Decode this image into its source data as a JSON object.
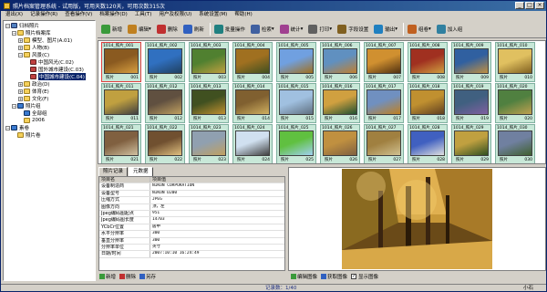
{
  "window": {
    "title": "照片档案管理系统 - 试用版，可用天数120天，可用次数315次"
  },
  "menu": [
    "退出(X)",
    "记录操作(R)",
    "查看操作(V)",
    "档案操作(D)",
    "工具(T)",
    "用户及权限(U)",
    "系统设置(M)",
    "帮助(H)"
  ],
  "tree": [
    {
      "label": "归档照片",
      "level": 0,
      "exp": "−",
      "icon": "root-icon"
    },
    {
      "label": "照片档案库",
      "level": 1,
      "exp": "−",
      "icon": "folder-icon"
    },
    {
      "label": "模型、图片(A.01)",
      "level": 2,
      "exp": "+",
      "icon": "folder-icon"
    },
    {
      "label": "人物(B)",
      "level": 2,
      "exp": "+",
      "icon": "folder-icon"
    },
    {
      "label": "风景(C)",
      "level": 2,
      "exp": "−",
      "icon": "folder-icon"
    },
    {
      "label": "中国风光(C.02)",
      "level": 3,
      "exp": "",
      "icon": "album-icon"
    },
    {
      "label": "国外城市建设(C.03)",
      "level": 3,
      "exp": "",
      "icon": "album-icon"
    },
    {
      "label": "中国城市建设(C.04)",
      "level": 3,
      "exp": "",
      "icon": "album-icon",
      "selected": true
    },
    {
      "label": "政治(D)",
      "level": 2,
      "exp": "+",
      "icon": "folder-icon"
    },
    {
      "label": "体育(E)",
      "level": 2,
      "exp": "+",
      "icon": "folder-icon"
    },
    {
      "label": "文化(F)",
      "level": 2,
      "exp": "+",
      "icon": "folder-icon"
    },
    {
      "label": "照片组",
      "level": 1,
      "exp": "−",
      "icon": "group-icon"
    },
    {
      "label": "全部组",
      "level": 2,
      "exp": "",
      "icon": "group-icon"
    },
    {
      "label": "2006",
      "level": 2,
      "exp": "",
      "icon": "folder-icon"
    },
    {
      "label": "素卷",
      "level": 0,
      "exp": "−",
      "icon": "group-icon"
    },
    {
      "label": "照片卷",
      "level": 1,
      "exp": "",
      "icon": "folder-icon"
    }
  ],
  "toolbar": [
    {
      "label": "新增",
      "icon": "add-icon",
      "color": "#3a9a3a"
    },
    {
      "label": "编辑",
      "icon": "edit-icon",
      "color": "#c08020",
      "dd": true
    },
    {
      "label": "删除",
      "icon": "delete-icon",
      "color": "#c03030"
    },
    {
      "label": "刷新",
      "icon": "refresh-icon",
      "color": "#3060c0",
      "sep": true
    },
    {
      "label": "批量操作",
      "icon": "batch-icon",
      "color": "#208080"
    },
    {
      "label": "检索",
      "icon": "search-icon",
      "color": "#4060a0",
      "dd": true
    },
    {
      "label": "统计",
      "icon": "stats-icon",
      "color": "#a04090",
      "dd": true
    },
    {
      "label": "打印",
      "icon": "print-icon",
      "color": "#606060",
      "dd": true
    },
    {
      "label": "字段设置",
      "icon": "fields-icon",
      "color": "#806020"
    },
    {
      "label": "输出",
      "icon": "export-icon",
      "color": "#2080c0",
      "dd": true,
      "sep": true
    },
    {
      "label": "组卷",
      "icon": "group-volume-icon",
      "color": "#c06020",
      "dd": true
    },
    {
      "label": "加入组",
      "icon": "add-to-group-icon",
      "color": "#3080a0"
    }
  ],
  "thumbnails": [
    {
      "id": "1014_照片_001",
      "l": "照片",
      "r": "001",
      "c1": "#8a5a20",
      "c2": "#d8a040",
      "sel": true
    },
    {
      "id": "1014_照片_002",
      "l": "照片",
      "r": "002",
      "c1": "#3070c0",
      "c2": "#204060"
    },
    {
      "id": "1014_照片_003",
      "l": "照片",
      "r": "003",
      "c1": "#508030",
      "c2": "#c0a040"
    },
    {
      "id": "1014_照片_004",
      "l": "照片",
      "r": "004",
      "c1": "#a07020",
      "c2": "#405020"
    },
    {
      "id": "1014_照片_005",
      "l": "照片",
      "r": "005",
      "c1": "#70a0e0",
      "c2": "#a07020"
    },
    {
      "id": "1014_照片_006",
      "l": "照片",
      "r": "006",
      "c1": "#6090c0",
      "c2": "#c08030"
    },
    {
      "id": "1014_照片_007",
      "l": "照片",
      "r": "007",
      "c1": "#d09030",
      "c2": "#503010"
    },
    {
      "id": "1014_照片_008",
      "l": "照片",
      "r": "008",
      "c1": "#a03020",
      "c2": "#d0a040"
    },
    {
      "id": "1014_照片_009",
      "l": "照片",
      "r": "009",
      "c1": "#3060a0",
      "c2": "#c09040"
    },
    {
      "id": "1014_照片_010",
      "l": "照片",
      "r": "010",
      "c1": "#e0c060",
      "c2": "#806020"
    },
    {
      "id": "1014_照片_011",
      "l": "照片",
      "r": "011",
      "c1": "#c0a040",
      "c2": "#404040"
    },
    {
      "id": "1014_照片_012",
      "l": "照片",
      "r": "012",
      "c1": "#605040",
      "c2": "#c0a060"
    },
    {
      "id": "1014_照片_013",
      "l": "照片",
      "r": "013",
      "c1": "#405020",
      "c2": "#c09030"
    },
    {
      "id": "1014_照片_014",
      "l": "照片",
      "r": "014",
      "c1": "#806030",
      "c2": "#d0b060"
    },
    {
      "id": "1014_照片_015",
      "l": "照片",
      "r": "015",
      "c1": "#a0c0e0",
      "c2": "#607080"
    },
    {
      "id": "1014_照片_016",
      "l": "照片",
      "r": "016",
      "c1": "#d0a040",
      "c2": "#205030"
    },
    {
      "id": "1014_照片_017",
      "l": "照片",
      "r": "017",
      "c1": "#7090c0",
      "c2": "#c08020"
    },
    {
      "id": "1014_照片_018",
      "l": "照片",
      "r": "018",
      "c1": "#c09030",
      "c2": "#604020"
    },
    {
      "id": "1014_照片_019",
      "l": "照片",
      "r": "019",
      "c1": "#406080",
      "c2": "#8060a0"
    },
    {
      "id": "1014_照片_020",
      "l": "照片",
      "r": "020",
      "c1": "#508040",
      "c2": "#c0a050"
    },
    {
      "id": "1014_照片_021",
      "l": "照片",
      "r": "021",
      "c1": "#806040",
      "c2": "#d0c0a0"
    },
    {
      "id": "1014_照片_022",
      "l": "照片",
      "r": "022",
      "c1": "#705030",
      "c2": "#e0c080"
    },
    {
      "id": "1014_照片_023",
      "l": "照片",
      "r": "023",
      "c1": "#90a0b0",
      "c2": "#c0a060"
    },
    {
      "id": "1014_照片_024",
      "l": "照片",
      "r": "024",
      "c1": "#d0e0f0",
      "c2": "#404040"
    },
    {
      "id": "1014_照片_025",
      "l": "照片",
      "r": "025",
      "c1": "#60c040",
      "c2": "#a0d0f0"
    },
    {
      "id": "1014_照片_026",
      "l": "照片",
      "r": "026",
      "c1": "#c09040",
      "c2": "#806040"
    },
    {
      "id": "1014_照片_027",
      "l": "照片",
      "r": "027",
      "c1": "#a08040",
      "c2": "#d0c090"
    },
    {
      "id": "1014_照片_028",
      "l": "照片",
      "r": "028",
      "c1": "#4060c0",
      "c2": "#e0e0e0"
    },
    {
      "id": "1014_照片_029",
      "l": "照片",
      "r": "029",
      "c1": "#c0a040",
      "c2": "#305020"
    },
    {
      "id": "1014_照片_030",
      "l": "照片",
      "r": "030",
      "c1": "#7080a0",
      "c2": "#406030"
    }
  ],
  "tabs": [
    "照片记录",
    "元数据"
  ],
  "metadata_header": [
    "项目名",
    "项目值"
  ],
  "metadata": [
    [
      "设备制造商",
      "NIKON CORPORATION"
    ],
    [
      "设备型号",
      "NIKON D200"
    ],
    [
      "压缩方式",
      "JPEG"
    ],
    [
      "图像方向",
      "顶，左"
    ],
    [
      "Jpeg编码图起点",
      "951"
    ],
    [
      "Jpeg编码图长度",
      "14703"
    ],
    [
      "YCbCr位置",
      "居中"
    ],
    [
      "水平分辨率",
      "300"
    ],
    [
      "垂直分辨率",
      "300"
    ],
    [
      "分辨率单位",
      "英寸"
    ],
    [
      "日期/时间",
      "2007:10:10 16:24:49"
    ]
  ],
  "detail_buttons": [
    {
      "label": "新增",
      "icon": "add-icon",
      "color": "#3a9a3a"
    },
    {
      "label": "删除",
      "icon": "delete-icon",
      "color": "#c03030"
    },
    {
      "label": "另存",
      "icon": "save-as-icon",
      "color": "#3060c0"
    }
  ],
  "preview_buttons": {
    "edit": "编辑图像",
    "acquire": "获取图像",
    "show": "显示图像",
    "show_checked": true
  },
  "status": {
    "records": "记录数：1/40",
    "font": "小石"
  }
}
